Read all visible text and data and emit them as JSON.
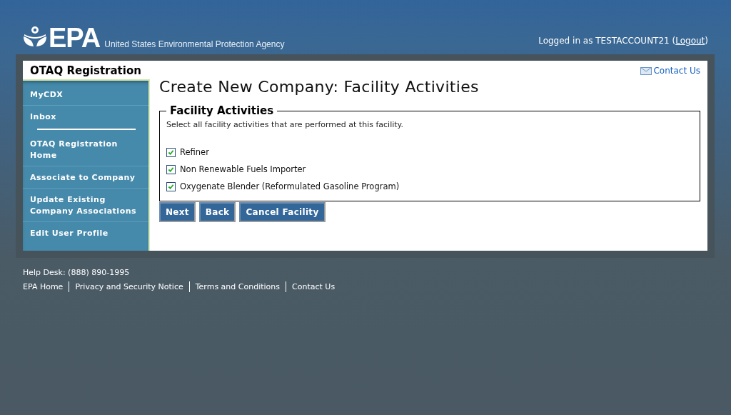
{
  "header": {
    "logo_text": "EPA",
    "agency": "United States Environmental Protection Agency",
    "login_prefix": "Logged in as TESTACCOUNT21 (",
    "logout": "Logout",
    "login_suffix": ")"
  },
  "sidebar": {
    "title": "OTAQ Registration",
    "top_items": [
      "MyCDX",
      "Inbox"
    ],
    "items": [
      "OTAQ Registration Home",
      "Associate to Company",
      "Update Existing Company Associations",
      "Edit User Profile"
    ]
  },
  "contact_link": "Contact Us",
  "page_title": "Create New Company: Facility Activities",
  "fieldset": {
    "legend": "Facility Activities",
    "instructions": "Select all facility activities that are performed at this facility.",
    "options": [
      {
        "label": "Refiner",
        "checked": true
      },
      {
        "label": "Non Renewable Fuels Importer",
        "checked": true
      },
      {
        "label": "Oxygenate Blender (Reformulated Gasoline Program)",
        "checked": true
      }
    ]
  },
  "buttons": [
    "Next",
    "Back",
    "Cancel Facility"
  ],
  "footer": {
    "help_desk": "Help Desk: (888) 890-1995",
    "links": [
      "EPA Home",
      "Privacy and Security Notice",
      "Terms and Conditions",
      "Contact Us"
    ]
  }
}
